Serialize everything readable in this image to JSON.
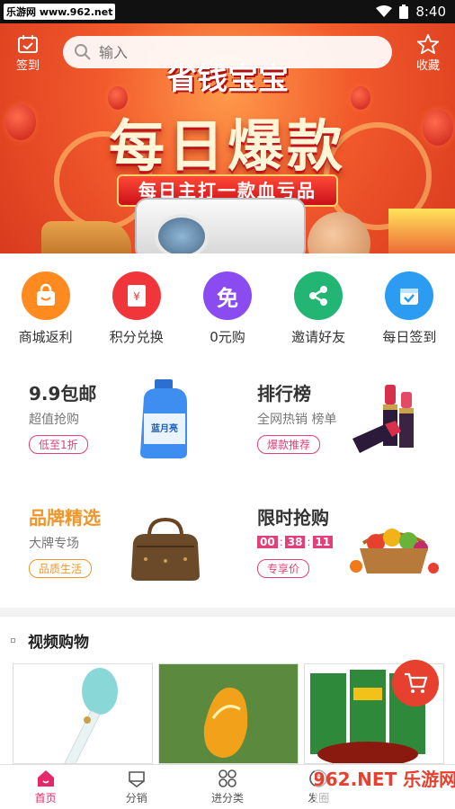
{
  "status_bar": {
    "left_text": "乐游网 www.962.net",
    "time": "8:40"
  },
  "banner": {
    "app_name": "省钱宝宝",
    "headline": "每日爆款",
    "subline": "每日主打一款血亏品",
    "checkin_label": "签到",
    "favorite_label": "收藏",
    "search_placeholder": "输入"
  },
  "categories": [
    {
      "label": "商城返利",
      "color": "#ff8a1f",
      "icon": "bag-icon"
    },
    {
      "label": "积分兑换",
      "color": "#f0353b",
      "icon": "red-envelope-icon"
    },
    {
      "label": "0元购",
      "color": "#8a4cf0",
      "icon": "free-icon",
      "glyph": "免"
    },
    {
      "label": "邀请好友",
      "color": "#22b573",
      "icon": "share-icon"
    },
    {
      "label": "每日签到",
      "color": "#2b9cf2",
      "icon": "calendar-check-icon"
    }
  ],
  "promos": {
    "baoyou": {
      "title": "9.9包邮",
      "subtitle": "超值抢购",
      "tag": "低至1折"
    },
    "ranking": {
      "title": "排行榜",
      "subtitle": "全网热销 榜单",
      "tag": "爆款推荐"
    },
    "brand": {
      "title": "品牌精选",
      "subtitle": "大牌专场",
      "tag": "品质生活",
      "accent": "#f0952a"
    },
    "flash": {
      "title": "限时抢购",
      "timer": [
        "00",
        "38",
        "11"
      ],
      "tag": "专享价"
    }
  },
  "video_section": {
    "title": "视频购物"
  },
  "tabs": [
    {
      "label": "首页",
      "icon": "home-icon",
      "active": true
    },
    {
      "label": "分销",
      "icon": "distribution-icon",
      "active": false
    },
    {
      "label": "进分类",
      "icon": "category-grid-icon",
      "active": false
    },
    {
      "label": "发圈",
      "icon": "camera-aperture-icon",
      "active": false
    }
  ],
  "watermark": "962.NET 乐游网",
  "colors": {
    "accent": "#e5286a",
    "banner_red": "#e1401f"
  }
}
